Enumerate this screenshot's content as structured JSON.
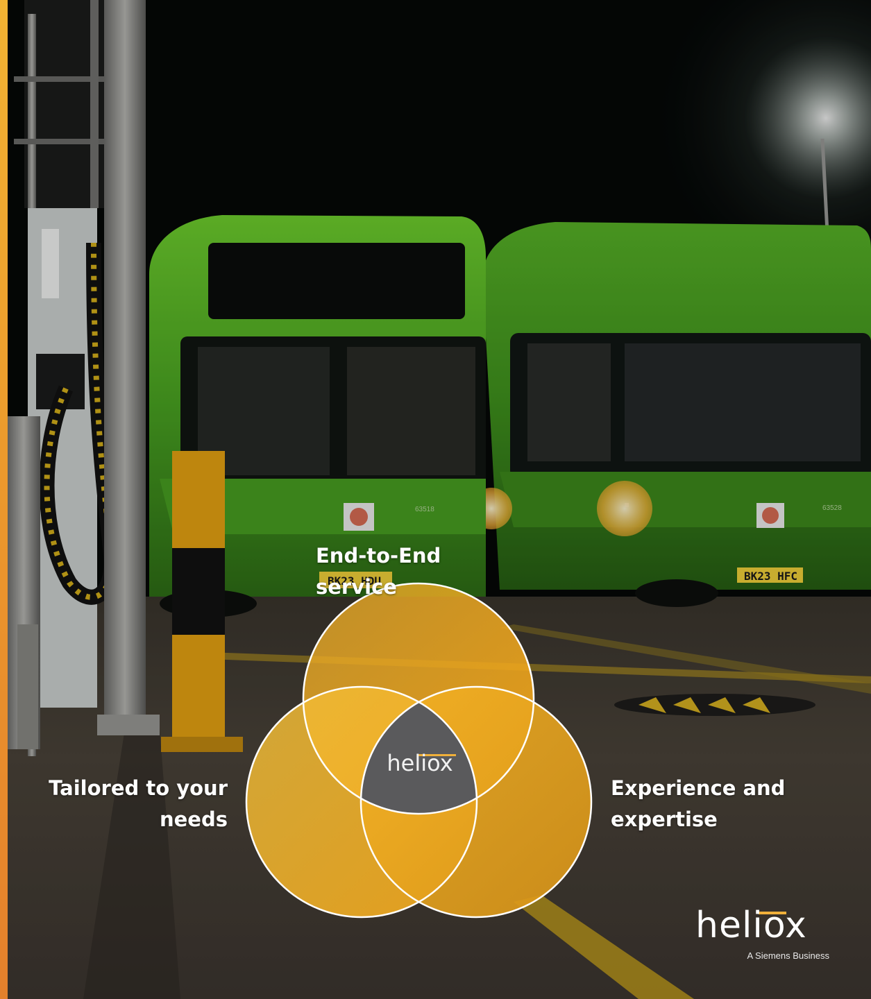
{
  "colors": {
    "accent": "#f2b233",
    "accent_dark": "#e4802c",
    "venn_yellow": "#f0b02e",
    "venn_center": "#5a5a5c",
    "bus_green": "#5fbf2a"
  },
  "diagram": {
    "top_label": "End-to-End service",
    "left_label_line1": "Tailored to your",
    "left_label_line2": "needs",
    "right_label_line1": "Experience and",
    "right_label_line2": "expertise",
    "center_logo": "heliox"
  },
  "brand": {
    "wordmark": "heliox",
    "tagline": "A Siemens Business"
  },
  "scene": {
    "plate_left": "BK23 HDU",
    "plate_right": "BK23 HFC",
    "fleet_left": "63518",
    "fleet_right": "63528"
  }
}
